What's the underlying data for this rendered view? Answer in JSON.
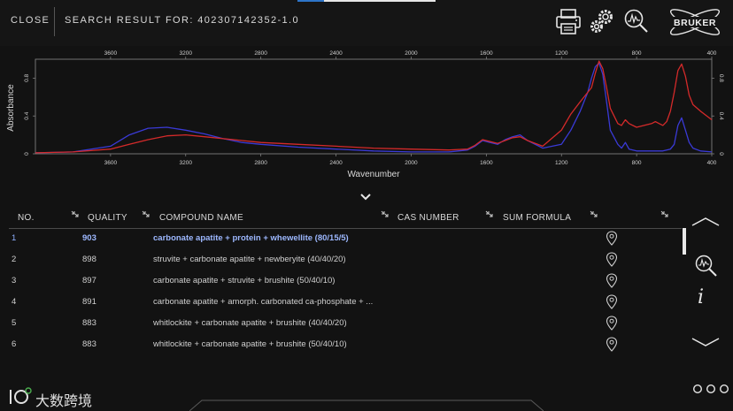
{
  "header": {
    "close_label": "CLOSE",
    "search_label": "SEARCH RESULT FOR: 402307142352-1.0",
    "icons": [
      "printer-icon",
      "gears-icon",
      "spectrum-search-icon",
      "bruker-logo"
    ],
    "brand": "BRUKER"
  },
  "chart_data": {
    "type": "line",
    "xlabel": "Wavenumber",
    "ylabel": "Absorbance",
    "xlim": [
      4000,
      400
    ],
    "ylim": [
      0,
      1.0
    ],
    "x_ticks": [
      3600,
      3200,
      2800,
      2400,
      2000,
      1600,
      1200,
      800,
      400
    ],
    "y_ticks": [
      "0",
      "0.4",
      "0.8"
    ],
    "grid": false,
    "series": [
      {
        "color": "#3a3ad6",
        "x": [
          4000,
          3800,
          3600,
          3500,
          3400,
          3300,
          3200,
          3100,
          3000,
          2900,
          2800,
          2600,
          2400,
          2200,
          2000,
          1800,
          1700,
          1660,
          1620,
          1580,
          1540,
          1500,
          1460,
          1420,
          1380,
          1300,
          1200,
          1150,
          1100,
          1060,
          1040,
          1020,
          1000,
          980,
          960,
          940,
          900,
          880,
          860,
          840,
          800,
          760,
          720,
          700,
          680,
          660,
          640,
          620,
          600,
          580,
          560,
          540,
          520,
          500,
          460,
          400
        ],
        "y": [
          0.01,
          0.02,
          0.08,
          0.2,
          0.27,
          0.28,
          0.25,
          0.21,
          0.16,
          0.12,
          0.1,
          0.07,
          0.05,
          0.03,
          0.02,
          0.02,
          0.04,
          0.08,
          0.14,
          0.12,
          0.1,
          0.15,
          0.18,
          0.2,
          0.14,
          0.06,
          0.1,
          0.25,
          0.45,
          0.65,
          0.8,
          0.92,
          0.96,
          0.84,
          0.55,
          0.25,
          0.1,
          0.06,
          0.12,
          0.05,
          0.03,
          0.03,
          0.03,
          0.03,
          0.03,
          0.03,
          0.04,
          0.05,
          0.1,
          0.3,
          0.38,
          0.25,
          0.12,
          0.06,
          0.03,
          0.02
        ]
      },
      {
        "color": "#d42a2a",
        "x": [
          4000,
          3800,
          3600,
          3500,
          3400,
          3300,
          3200,
          3100,
          3000,
          2900,
          2800,
          2600,
          2400,
          2200,
          2000,
          1800,
          1700,
          1660,
          1620,
          1580,
          1540,
          1500,
          1460,
          1420,
          1380,
          1300,
          1200,
          1150,
          1100,
          1060,
          1040,
          1020,
          1000,
          980,
          960,
          940,
          900,
          880,
          860,
          840,
          800,
          760,
          720,
          700,
          680,
          660,
          640,
          620,
          600,
          580,
          560,
          540,
          520,
          500,
          460,
          400
        ],
        "y": [
          0.01,
          0.02,
          0.05,
          0.1,
          0.15,
          0.19,
          0.2,
          0.18,
          0.16,
          0.14,
          0.12,
          0.1,
          0.08,
          0.06,
          0.05,
          0.04,
          0.05,
          0.09,
          0.15,
          0.13,
          0.11,
          0.14,
          0.17,
          0.18,
          0.14,
          0.08,
          0.25,
          0.42,
          0.55,
          0.65,
          0.7,
          0.85,
          0.98,
          0.9,
          0.7,
          0.48,
          0.32,
          0.3,
          0.36,
          0.32,
          0.28,
          0.3,
          0.32,
          0.34,
          0.32,
          0.3,
          0.34,
          0.45,
          0.65,
          0.88,
          0.95,
          0.82,
          0.62,
          0.52,
          0.45,
          0.36
        ]
      }
    ]
  },
  "table": {
    "columns": {
      "no": "NO.",
      "quality": "QUALITY",
      "compound": "COMPOUND NAME",
      "cas": "CAS NUMBER",
      "formula": "SUM FORMULA"
    },
    "rows": [
      {
        "no": "1",
        "quality": "903",
        "compound": "carbonate apatite + protein + whewellite (80/15/5)",
        "selected": true
      },
      {
        "no": "2",
        "quality": "898",
        "compound": "struvite + carbonate apatite + newberyite (40/40/20)",
        "selected": false
      },
      {
        "no": "3",
        "quality": "897",
        "compound": "carbonate apatite + struvite + brushite (50/40/10)",
        "selected": false
      },
      {
        "no": "4",
        "quality": "891",
        "compound": "carbonate apatite + amorph. carbonated ca-phosphate + ...",
        "selected": false
      },
      {
        "no": "5",
        "quality": "883",
        "compound": "whitlockite + carbonate apatite + brushite (40/40/20)",
        "selected": false
      },
      {
        "no": "6",
        "quality": "883",
        "compound": "whitlockite + carbonate apatite + brushite (50/40/10)",
        "selected": false
      }
    ]
  },
  "rail": {
    "icons": [
      "chevron-up-icon",
      "magnify-spectrum-icon",
      "info-icon",
      "chevron-down-icon"
    ],
    "info_label": "i"
  },
  "footer": {
    "watermark_text": "大数跨境",
    "more_icon": "more-dots-icon"
  }
}
